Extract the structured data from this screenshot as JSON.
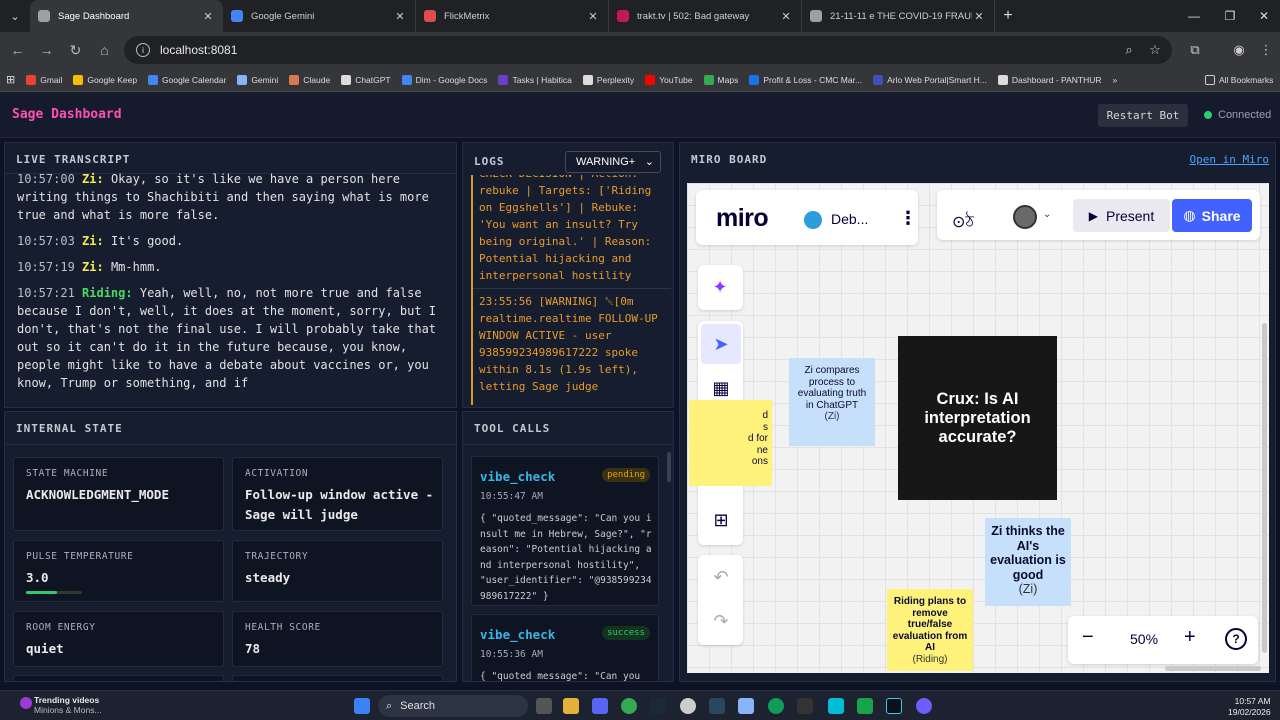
{
  "browser": {
    "tabs": [
      {
        "title": "Sage Dashboard",
        "color": "#9aa0a6",
        "active": true
      },
      {
        "title": "Google Gemini",
        "color": "#4285f4",
        "active": false
      },
      {
        "title": "FlickMetrix",
        "color": "#e34c4c",
        "active": false
      },
      {
        "title": "trakt.tv | 502: Bad gateway",
        "color": "#c2185b",
        "active": false
      },
      {
        "title": "21-11-11 e THE COVID-19 FRAUD & ...",
        "color": "#9aa0a6",
        "active": false
      }
    ],
    "url": "localhost:8081",
    "bookmarks": [
      {
        "label": "Gmail",
        "color": "#ea4335"
      },
      {
        "label": "Google Keep",
        "color": "#fbbc04"
      },
      {
        "label": "Google Calendar",
        "color": "#4285f4"
      },
      {
        "label": "Gemini",
        "color": "#8ab4f8"
      },
      {
        "label": "Claude",
        "color": "#d97757"
      },
      {
        "label": "ChatGPT",
        "color": "#dddddd"
      },
      {
        "label": "Dim - Google Docs",
        "color": "#4285f4"
      },
      {
        "label": "Tasks | Habitica",
        "color": "#6c3fc9"
      },
      {
        "label": "Perplexity",
        "color": "#dddddd"
      },
      {
        "label": "YouTube",
        "color": "#ff0000"
      },
      {
        "label": "Maps",
        "color": "#34a853"
      },
      {
        "label": "Profit & Loss - CMC Mar...",
        "color": "#1a73e8"
      },
      {
        "label": "Arlo Web Portal|Smart H...",
        "color": "#3f51b5"
      },
      {
        "label": "Dashboard - PANTHUR",
        "color": "#dddddd"
      }
    ],
    "all_bookmarks": "All Bookmarks"
  },
  "app": {
    "title": "Sage Dashboard",
    "restart_label": "Restart Bot",
    "status": "Connected"
  },
  "transcript": {
    "title": "LIVE TRANSCRIPT",
    "entries": [
      {
        "ts": "10:57:00",
        "speaker": "Zi:",
        "color": "#f2e94e",
        "text": "Okay, so it's like we have a person here writing things to Shachibiti and then saying what is more true and what is more false."
      },
      {
        "ts": "10:57:03",
        "speaker": "Zi:",
        "color": "#f2e94e",
        "text": "It's good."
      },
      {
        "ts": "10:57:19",
        "speaker": "Zi:",
        "color": "#f2e94e",
        "text": "Mm-hmm."
      },
      {
        "ts": "10:57:21",
        "speaker": "Riding:",
        "color": "#4cd964",
        "text": "Yeah, well, no, not more true and false because I don't, well, it does at the moment, sorry, but I don't, that's not the final use. I will probably take that out so it can't do it in the future because, you know, people might like to have a debate about vaccines or, you know, Trump or something, and if"
      }
    ]
  },
  "logs": {
    "title": "LOGS",
    "filter": "WARNING+",
    "entries": [
      "CHECK DECISION | Action: rebuke | Targets: ['Riding on Eggshells'] | Rebuke: 'You want an insult? Try being original.' | Reason: Potential hijacking and interpersonal hostility",
      "23:55:56  [WARNING]  ␛[0m realtime.realtime FOLLOW-UP WINDOW ACTIVE - user 938599234989617222 spoke within 8.1s (1.9s left), letting Sage judge"
    ]
  },
  "internal": {
    "title": "INTERNAL STATE",
    "cards": [
      {
        "key": "STATE MACHINE",
        "value": "ACKNOWLEDGMENT_MODE"
      },
      {
        "key": "ACTIVATION",
        "value": "Follow-up window active - Sage will judge"
      },
      {
        "key": "PULSE TEMPERATURE",
        "value": "3.0",
        "gauge_fraction": 0.3
      },
      {
        "key": "TRAJECTORY",
        "value": "steady"
      },
      {
        "key": "ROOM ENERGY",
        "value": "quiet"
      },
      {
        "key": "HEALTH SCORE",
        "value": "78"
      }
    ]
  },
  "tools": {
    "title": "TOOL CALLS",
    "calls": [
      {
        "name": "vibe_check",
        "status": "pending",
        "status_color": "#e0a400",
        "status_bg": "#3a3014",
        "time": "10:55:47 AM",
        "payload": "{ \"quoted_message\": \"Can you insult me in Hebrew, Sage?\", \"reason\": \"Potential hijacking and interpersonal hostility\", \"user_identifier\": \"@938599234989617222\" }"
      },
      {
        "name": "vibe_check",
        "status": "success",
        "status_color": "#2ecc71",
        "status_bg": "#14331f",
        "time": "10:55:36 AM",
        "payload": "{ \"quoted_message\": \"Can you"
      }
    ]
  },
  "miro": {
    "title": "MIRO BOARD",
    "open_link": "Open in Miro",
    "logo": "miro",
    "board_name": "Deb...",
    "present": "Present",
    "share": "Share",
    "zoom": "50%",
    "stickies": [
      {
        "text": "Zi compares process to evaluating truth in ChatGPT",
        "who": "(Zi)",
        "color": "#c6e0fb"
      },
      {
        "text": "Zi thinks the AI's evaluation is good",
        "who": "(Zi)",
        "color": "#c6e0fb"
      },
      {
        "text": "Riding plans to remove true/false evaluation from AI",
        "who": "(Riding)",
        "color": "#fff27a"
      },
      {
        "text": "d\ns\nd for\nne\nons",
        "who": "",
        "color": "#fff27a"
      }
    ],
    "crux": "Crux: Is AI interpretation accurate?"
  },
  "taskbar": {
    "weather_line1": "Trending videos",
    "weather_line2": "Minions & Mons...",
    "search": "Search",
    "time": "10:57 AM",
    "date": "19/02/2026"
  }
}
